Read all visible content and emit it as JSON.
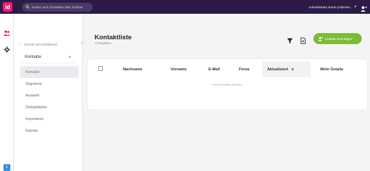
{
  "topbar": {
    "logo": "id",
    "search_placeholder": "Suche nach Kontakten oder Schluss",
    "user_name": "Administrator Konto (Adminis...",
    "user_chevron": "▾"
  },
  "subnav": {
    "back_label": "Zurück zum Dashboard",
    "section_label": "Kontakte",
    "items": [
      {
        "label": "Kontakte",
        "active": true
      },
      {
        "label": "Segmente",
        "active": false
      },
      {
        "label": "Auswahl",
        "active": false
      },
      {
        "label": "Deduplikation",
        "active": false
      },
      {
        "label": "Importieren",
        "active": false
      },
      {
        "label": "Exporte",
        "active": false
      }
    ]
  },
  "main": {
    "title": "Kontaktliste",
    "subtitle": "0 Eingaben",
    "add_button_label": "Kontakt hinzufügen",
    "columns": [
      "Nachname",
      "Vorname",
      "E-Mail",
      "Firma",
      "Aktualisiert",
      "Mehr Details"
    ],
    "sorted_indicator": "∨",
    "empty_message": "Keine Kontakte gefunden"
  },
  "colors": {
    "topbar": "#2d1a47",
    "accent_green": "#7dbb36",
    "logo_pink": "#e91e73",
    "active_item_bg": "#eaeaee"
  },
  "icons": [
    "search-icon",
    "user-icon",
    "contacts-icon",
    "settings-icon",
    "help-icon",
    "back-arrow-icon",
    "chevron-left-icon",
    "chevron-up-icon",
    "filter-icon",
    "export-icon",
    "add-user-icon",
    "sort-chevron-icon"
  ]
}
